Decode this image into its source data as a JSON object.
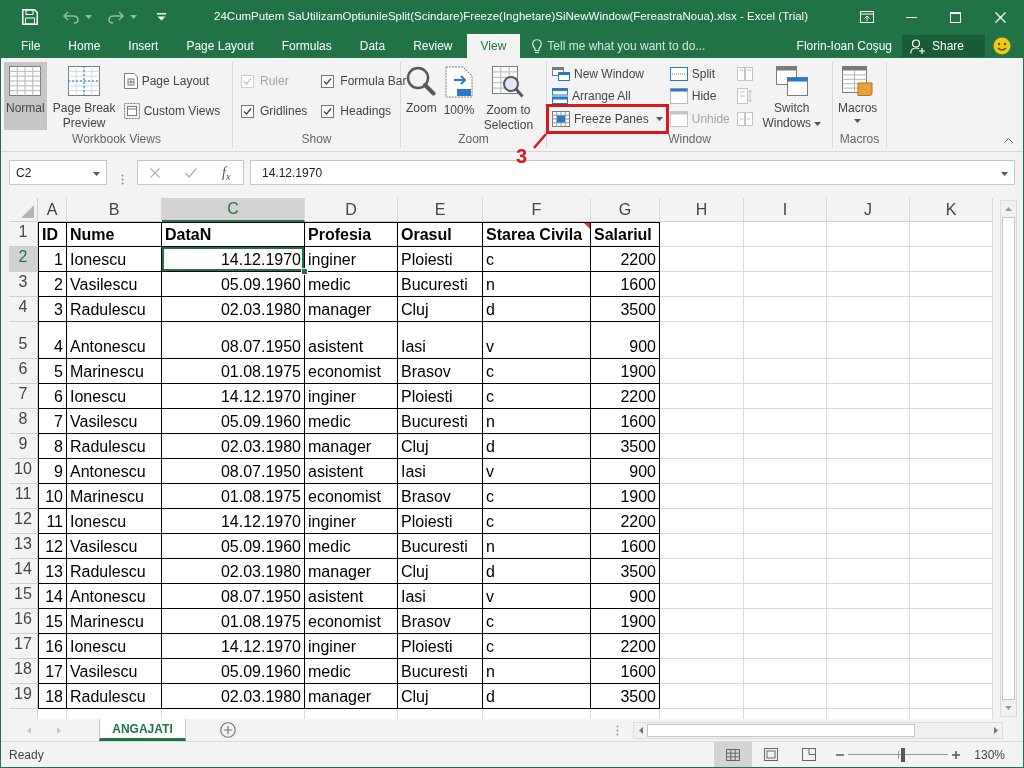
{
  "window": {
    "title": "24CumPutem SaUtilizamOptiunileSplit(Scindare)Freeze(Inghetare)SiNewWindow(FereastraNoua).xlsx - Excel (Trial)"
  },
  "tabs": [
    {
      "label": "File",
      "selected": false
    },
    {
      "label": "Home",
      "selected": false
    },
    {
      "label": "Insert",
      "selected": false
    },
    {
      "label": "Page Layout",
      "selected": false
    },
    {
      "label": "Formulas",
      "selected": false
    },
    {
      "label": "Data",
      "selected": false
    },
    {
      "label": "Review",
      "selected": false
    },
    {
      "label": "View",
      "selected": true
    }
  ],
  "tell_me": {
    "placeholder": "Tell me what you want to do..."
  },
  "account": {
    "user": "Florin-Ioan Coşug",
    "share": "Share"
  },
  "ribbon": {
    "groups": [
      {
        "label": "Workbook Views",
        "items": [
          {
            "kind": "large",
            "label": "Normal",
            "selected": true
          },
          {
            "kind": "large",
            "label": "Page Break Preview",
            "selected": false
          },
          {
            "kind": "stack",
            "items": [
              {
                "kind": "small",
                "label": "Page Layout",
                "selected": false
              },
              {
                "kind": "small",
                "label": "Custom Views",
                "selected": false
              }
            ]
          }
        ]
      },
      {
        "label": "Show",
        "items": [
          {
            "kind": "stack",
            "items": [
              {
                "kind": "checkbox",
                "label": "Ruler",
                "checked": true,
                "disabled": true
              },
              {
                "kind": "checkbox",
                "label": "Gridlines",
                "checked": true,
                "disabled": false
              }
            ]
          },
          {
            "kind": "stack",
            "items": [
              {
                "kind": "checkbox",
                "label": "Formula Bar",
                "checked": true,
                "disabled": false
              },
              {
                "kind": "checkbox",
                "label": "Headings",
                "checked": true,
                "disabled": false
              }
            ]
          }
        ]
      },
      {
        "label": "Zoom",
        "items": [
          {
            "kind": "large",
            "label": "Zoom"
          },
          {
            "kind": "large",
            "label": "100%"
          },
          {
            "kind": "large",
            "label": "Zoom to Selection"
          }
        ]
      },
      {
        "label": "Window",
        "items": [
          {
            "kind": "stack",
            "items": [
              {
                "kind": "small",
                "label": "New Window",
                "disabled": false,
                "dropdown": false,
                "annotated": false
              },
              {
                "kind": "small",
                "label": "Arrange All",
                "disabled": false,
                "dropdown": false,
                "annotated": false
              },
              {
                "kind": "small",
                "label": "Freeze Panes",
                "disabled": false,
                "dropdown": true,
                "annotated": true
              }
            ]
          },
          {
            "kind": "stack",
            "items": [
              {
                "kind": "small",
                "label": "Split",
                "disabled": false
              },
              {
                "kind": "small",
                "label": "Hide",
                "disabled": false
              },
              {
                "kind": "small",
                "label": "Unhide",
                "disabled": true
              }
            ]
          },
          {
            "kind": "stack",
            "items": [
              {
                "kind": "icon",
                "disabled": true
              },
              {
                "kind": "icon",
                "disabled": true
              },
              {
                "kind": "icon",
                "disabled": true
              }
            ]
          },
          {
            "kind": "large",
            "label": "Switch Windows",
            "dropdown": true
          }
        ]
      },
      {
        "label": "Macros",
        "items": [
          {
            "kind": "large",
            "label": "Macros",
            "dropdown": true
          }
        ]
      }
    ]
  },
  "annotation": {
    "label": "3"
  },
  "formula_bar": {
    "name_box": "C2",
    "function_label": "f$_{x}$",
    "formula": "14.12.1970"
  },
  "sheet": {
    "columns": [
      {
        "label": "A",
        "selected": false
      },
      {
        "label": "B",
        "selected": false
      },
      {
        "label": "C",
        "selected": true
      },
      {
        "label": "D",
        "selected": false
      },
      {
        "label": "E",
        "selected": false
      },
      {
        "label": "F",
        "selected": false
      },
      {
        "label": "G",
        "selected": false
      },
      {
        "label": "H",
        "selected": false
      },
      {
        "label": "I",
        "selected": false
      },
      {
        "label": "J",
        "selected": false
      },
      {
        "label": "K",
        "selected": false
      }
    ],
    "header": {
      "number": "1",
      "selected": false,
      "tall": false,
      "cells": [
        {
          "text": "ID",
          "comment": false
        },
        {
          "text": "Nume",
          "comment": false
        },
        {
          "text": "DataN",
          "comment": false
        },
        {
          "text": "Profesia",
          "comment": false
        },
        {
          "text": "Orasul",
          "comment": false
        },
        {
          "text": "Starea Civila",
          "comment": true
        },
        {
          "text": "Salariul",
          "comment": false
        }
      ]
    },
    "rows": [
      {
        "number": "2",
        "selected": true,
        "tall": false,
        "cells": [
          "1",
          "Ionescu",
          "14.12.1970",
          "inginer",
          "Ploiesti",
          "c",
          "2200"
        ]
      },
      {
        "number": "3",
        "selected": false,
        "tall": false,
        "cells": [
          "2",
          "Vasilescu",
          "05.09.1960",
          "medic",
          "Bucuresti",
          "n",
          "1600"
        ]
      },
      {
        "number": "4",
        "selected": false,
        "tall": false,
        "cells": [
          "3",
          "Radulescu",
          "02.03.1980",
          "manager",
          "Cluj",
          "d",
          "3500"
        ]
      },
      {
        "number": "5",
        "selected": false,
        "tall": true,
        "cells": [
          "4",
          "Antonescu",
          "08.07.1950",
          "asistent",
          "Iasi",
          "v",
          "900"
        ]
      },
      {
        "number": "6",
        "selected": false,
        "tall": false,
        "cells": [
          "5",
          "Marinescu",
          "01.08.1975",
          "economist",
          "Brasov",
          "c",
          "1900"
        ]
      },
      {
        "number": "7",
        "selected": false,
        "tall": false,
        "cells": [
          "6",
          "Ionescu",
          "14.12.1970",
          "inginer",
          "Ploiesti",
          "c",
          "2200"
        ]
      },
      {
        "number": "8",
        "selected": false,
        "tall": false,
        "cells": [
          "7",
          "Vasilescu",
          "05.09.1960",
          "medic",
          "Bucuresti",
          "n",
          "1600"
        ]
      },
      {
        "number": "9",
        "selected": false,
        "tall": false,
        "cells": [
          "8",
          "Radulescu",
          "02.03.1980",
          "manager",
          "Cluj",
          "d",
          "3500"
        ]
      },
      {
        "number": "10",
        "selected": false,
        "tall": false,
        "cells": [
          "9",
          "Antonescu",
          "08.07.1950",
          "asistent",
          "Iasi",
          "v",
          "900"
        ]
      },
      {
        "number": "11",
        "selected": false,
        "tall": false,
        "cells": [
          "10",
          "Marinescu",
          "01.08.1975",
          "economist",
          "Brasov",
          "c",
          "1900"
        ]
      },
      {
        "number": "12",
        "selected": false,
        "tall": false,
        "cells": [
          "11",
          "Ionescu",
          "14.12.1970",
          "inginer",
          "Ploiesti",
          "c",
          "2200"
        ]
      },
      {
        "number": "13",
        "selected": false,
        "tall": false,
        "cells": [
          "12",
          "Vasilescu",
          "05.09.1960",
          "medic",
          "Bucuresti",
          "n",
          "1600"
        ]
      },
      {
        "number": "14",
        "selected": false,
        "tall": false,
        "cells": [
          "13",
          "Radulescu",
          "02.03.1980",
          "manager",
          "Cluj",
          "d",
          "3500"
        ]
      },
      {
        "number": "15",
        "selected": false,
        "tall": false,
        "cells": [
          "14",
          "Antonescu",
          "08.07.1950",
          "asistent",
          "Iasi",
          "v",
          "900"
        ]
      },
      {
        "number": "16",
        "selected": false,
        "tall": false,
        "cells": [
          "15",
          "Marinescu",
          "01.08.1975",
          "economist",
          "Brasov",
          "c",
          "1900"
        ]
      },
      {
        "number": "17",
        "selected": false,
        "tall": false,
        "cells": [
          "16",
          "Ionescu",
          "14.12.1970",
          "inginer",
          "Ploiesti",
          "c",
          "2200"
        ]
      },
      {
        "number": "18",
        "selected": false,
        "tall": false,
        "cells": [
          "17",
          "Vasilescu",
          "05.09.1960",
          "medic",
          "Bucuresti",
          "n",
          "1600"
        ]
      },
      {
        "number": "19",
        "selected": false,
        "tall": false,
        "cells": [
          "18",
          "Radulescu",
          "02.03.1980",
          "manager",
          "Cluj",
          "d",
          "3500"
        ]
      }
    ]
  },
  "sheet_tabs": [
    {
      "label": "ANGAJATI",
      "selected": true
    }
  ],
  "status_bar": {
    "status": "Ready",
    "views": [
      {
        "kind": "normal",
        "selected": true
      },
      {
        "kind": "page_layout",
        "selected": false
      },
      {
        "kind": "page_break",
        "selected": false
      }
    ],
    "zoom": {
      "level": 0.55,
      "reading": "130%"
    }
  }
}
